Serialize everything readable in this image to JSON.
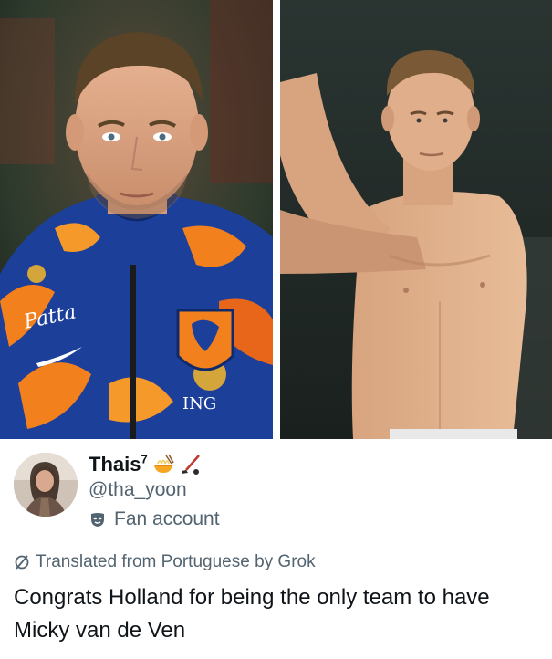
{
  "tweet": {
    "display_name": "Thais",
    "display_name_superscript": "7",
    "name_emoji_icons": [
      "noodle-bowl-icon",
      "hockey-stick-icon"
    ],
    "handle": "@tha_yoon",
    "account_label": "Fan account",
    "account_label_icon": "mask-icon",
    "translation_note": "Translated from Portuguese by Grok",
    "translation_icon": "slash-circle-icon",
    "text": "Congrats Holland for being the only team to have Micky van de Ven"
  },
  "photos": {
    "left": {
      "description_icon": "player-photo-jacket",
      "visible_text": [
        "Patta",
        "ING"
      ]
    },
    "right": {
      "description_icon": "player-photo-shirtless"
    }
  },
  "colors": {
    "text_primary": "#0f1419",
    "text_secondary": "#536471",
    "background": "#ffffff",
    "jacket_blue": "#1c3f9a",
    "jacket_orange": "#f2811d"
  }
}
